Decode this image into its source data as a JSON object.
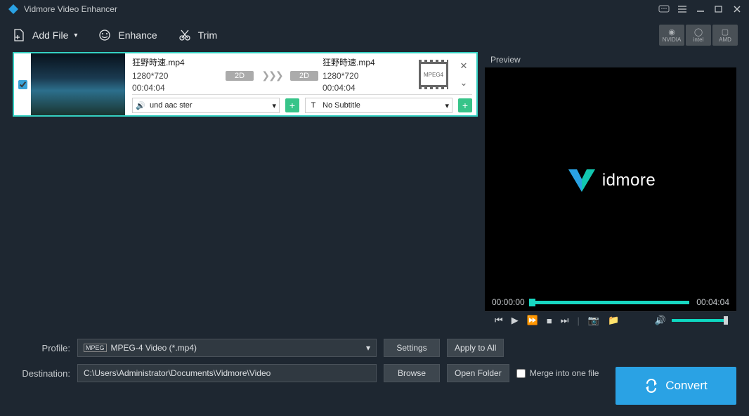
{
  "app": {
    "title": "Vidmore Video Enhancer"
  },
  "toolbar": {
    "add_file": "Add File",
    "enhance": "Enhance",
    "trim": "Trim",
    "gpu": [
      "NVIDIA",
      "intel",
      "AMD"
    ]
  },
  "file": {
    "src": {
      "name": "狂野時速.mp4",
      "res": "1280*720",
      "dur": "00:04:04"
    },
    "dst": {
      "name": "狂野時速.mp4",
      "res": "1280*720",
      "dur": "00:04:04"
    },
    "badge_2d": "2D",
    "fmt_badge": "MPEG4",
    "audio_dd": "und aac ster",
    "subtitle_dd": "No Subtitle"
  },
  "preview": {
    "label": "Preview",
    "brand": "idmore",
    "cur": "00:00:00",
    "len": "00:04:04"
  },
  "profile": {
    "label": "Profile:",
    "value": "MPEG-4 Video (*.mp4)",
    "settings": "Settings",
    "apply_all": "Apply to All"
  },
  "destination": {
    "label": "Destination:",
    "value": "C:\\Users\\Administrator\\Documents\\Vidmore\\Video",
    "browse": "Browse",
    "open_folder": "Open Folder",
    "merge": "Merge into one file"
  },
  "convert": "Convert"
}
